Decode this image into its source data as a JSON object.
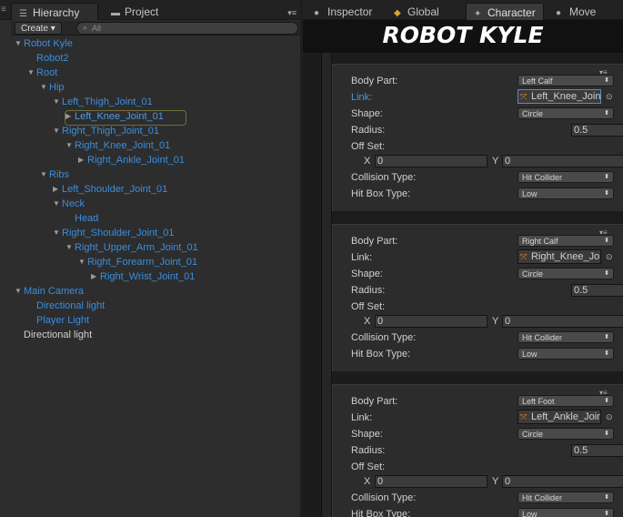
{
  "hierarchy": {
    "tab_label": "Hierarchy",
    "project_tab_label": "Project",
    "create_label": "Create",
    "search_placeholder": "All",
    "tree": [
      {
        "label": "Robot Kyle",
        "arrow": "open",
        "color": "blue"
      },
      {
        "label": "Robot2",
        "arrow": "none",
        "color": "blue"
      },
      {
        "label": "Root",
        "arrow": "open",
        "color": "blue"
      },
      {
        "label": "Hip",
        "arrow": "open",
        "color": "blue"
      },
      {
        "label": "Left_Thigh_Joint_01",
        "arrow": "open",
        "color": "blue"
      },
      {
        "label": "Left_Knee_Joint_01",
        "arrow": "closed",
        "color": "blue",
        "selected": true
      },
      {
        "label": "Right_Thigh_Joint_01",
        "arrow": "open",
        "color": "blue"
      },
      {
        "label": "Right_Knee_Joint_01",
        "arrow": "open",
        "color": "blue"
      },
      {
        "label": "Right_Ankle_Joint_01",
        "arrow": "closed",
        "color": "blue"
      },
      {
        "label": "Ribs",
        "arrow": "open",
        "color": "blue"
      },
      {
        "label": "Left_Shoulder_Joint_01",
        "arrow": "closed",
        "color": "blue"
      },
      {
        "label": "Neck",
        "arrow": "open",
        "color": "blue"
      },
      {
        "label": "Head",
        "arrow": "none",
        "color": "blue"
      },
      {
        "label": "Right_Shoulder_Joint_01",
        "arrow": "open",
        "color": "blue"
      },
      {
        "label": "Right_Upper_Arm_Joint_01",
        "arrow": "open",
        "color": "blue"
      },
      {
        "label": "Right_Forearm_Joint_01",
        "arrow": "open",
        "color": "blue"
      },
      {
        "label": "Right_Wrist_Joint_01",
        "arrow": "closed",
        "color": "blue"
      },
      {
        "label": "Main Camera",
        "arrow": "open",
        "color": "blue"
      },
      {
        "label": "Directional light",
        "arrow": "none",
        "color": "blue"
      },
      {
        "label": "Player Light",
        "arrow": "none",
        "color": "blue"
      },
      {
        "label": "Directional light",
        "arrow": "none",
        "color": "plain"
      }
    ]
  },
  "inspector": {
    "tabs": {
      "inspector": "Inspector",
      "global": "Global",
      "character": "Character",
      "move": "Move"
    },
    "banner": "ROBOT KYLE",
    "labels": {
      "body_part": "Body Part:",
      "link": "Link:",
      "shape": "Shape:",
      "radius": "Radius:",
      "offset": "Off Set:",
      "x": "X",
      "y": "Y",
      "collision_type": "Collision Type:",
      "hitbox_type": "Hit Box Type:"
    },
    "cards": [
      {
        "body_part": "Left Calf",
        "link": "Left_Knee_Joint",
        "link_focused": true,
        "shape": "Circle",
        "radius": "0.5",
        "x": "0",
        "y": "0",
        "collision_type": "Hit Collider",
        "hitbox_type": "Low"
      },
      {
        "body_part": "Right Calf",
        "link": "Right_Knee_Joint",
        "link_focused": false,
        "shape": "Circle",
        "radius": "0.5",
        "x": "0",
        "y": "0",
        "collision_type": "Hit Collider",
        "hitbox_type": "Low"
      },
      {
        "body_part": "Left Foot",
        "link": "Left_Ankle_Joint",
        "link_focused": false,
        "shape": "Circle",
        "radius": "0.5",
        "x": "0",
        "y": "0",
        "collision_type": "Hit Collider",
        "hitbox_type": "Low"
      }
    ]
  },
  "colors": {
    "link_blue": "#3a8ee0",
    "panel_bg": "#2d2d2d",
    "inspector_bg": "#1c1c1c"
  }
}
